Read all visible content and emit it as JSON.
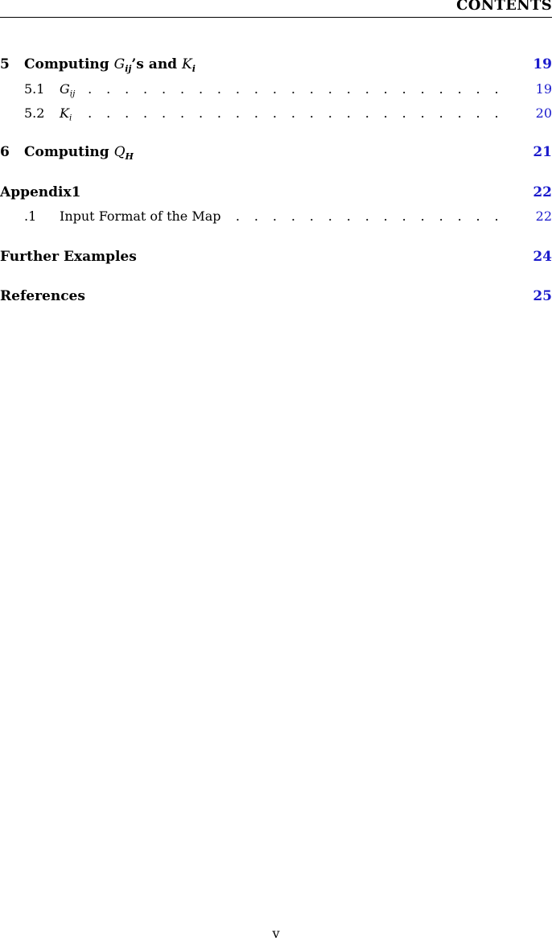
{
  "header": {
    "running_head": "CONTENTS"
  },
  "toc": {
    "ch5": {
      "number": "5",
      "title_pre": "Computing ",
      "math1_base": "G",
      "math1_sub": "ij",
      "title_mid": "’s and ",
      "math2_base": "K",
      "math2_sub": "i",
      "page": "19"
    },
    "s51": {
      "number": "5.1",
      "math_base": "G",
      "math_sub": "ij",
      "page": "19"
    },
    "s52": {
      "number": "5.2",
      "math_base": "K",
      "math_sub": "i",
      "page": "20"
    },
    "ch6": {
      "number": "6",
      "title_pre": "Computing ",
      "math_base": "Q",
      "math_sub": "H",
      "page": "21"
    },
    "appendix": {
      "title": "Appendix1",
      "page": "22"
    },
    "s_app1": {
      "number": ".1",
      "title": "Input Format of the Map",
      "page": "22"
    },
    "further": {
      "title": "Further Examples",
      "page": "24"
    },
    "references": {
      "title": "References",
      "page": "25"
    }
  },
  "footer": {
    "page_number": "v"
  }
}
